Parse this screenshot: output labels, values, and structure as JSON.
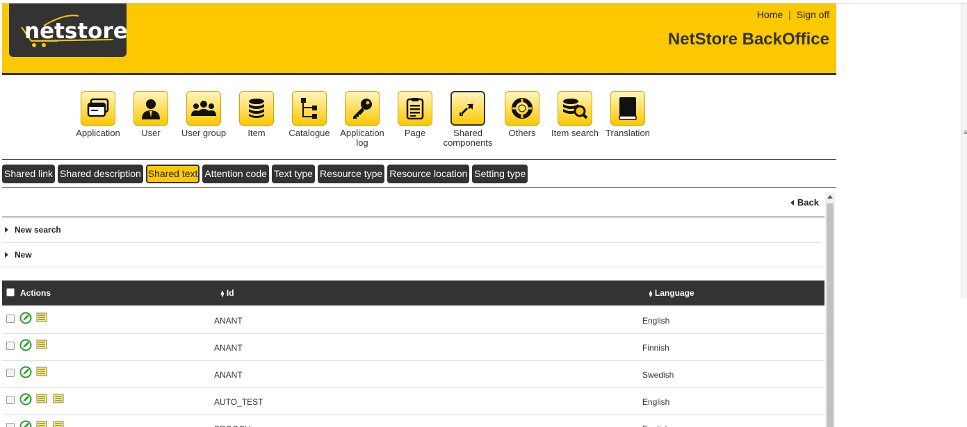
{
  "header": {
    "logo_text": "netstore",
    "links": {
      "home": "Home",
      "sep": "|",
      "signoff": "Sign off"
    },
    "title": "NetStore BackOffice"
  },
  "main_nav": [
    {
      "label": "Application",
      "icon": "application-window-icon"
    },
    {
      "label": "User",
      "icon": "user-icon"
    },
    {
      "label": "User group",
      "icon": "user-group-icon"
    },
    {
      "label": "Item",
      "icon": "item-stack-icon"
    },
    {
      "label": "Catalogue",
      "icon": "catalogue-tree-icon"
    },
    {
      "label": "Application",
      "label2": "log",
      "icon": "key-icon"
    },
    {
      "label": "Page",
      "icon": "page-document-icon"
    },
    {
      "label": "Shared",
      "label2": "components",
      "icon": "shared-link-icon",
      "active": true
    },
    {
      "label": "Others",
      "icon": "lifebuoy-icon"
    },
    {
      "label": "Item search",
      "icon": "item-search-icon"
    },
    {
      "label": "Translation",
      "icon": "book-icon"
    }
  ],
  "sub_nav": [
    {
      "label": "Shared link"
    },
    {
      "label": "Shared description"
    },
    {
      "label": "Shared text",
      "active": true
    },
    {
      "label": "Attention code"
    },
    {
      "label": "Text type"
    },
    {
      "label": "Resource type"
    },
    {
      "label": "Resource location"
    },
    {
      "label": "Setting type"
    }
  ],
  "content": {
    "back_label": "Back",
    "new_search_label": "New search",
    "new_label": "New"
  },
  "table": {
    "headers": {
      "actions": "Actions",
      "id": "Id",
      "language": "Language"
    },
    "rows": [
      {
        "id": "ANANT",
        "language": "English",
        "extra_doc": false
      },
      {
        "id": "ANANT",
        "language": "Finnish",
        "extra_doc": false
      },
      {
        "id": "ANANT",
        "language": "Swedish",
        "extra_doc": false
      },
      {
        "id": "AUTO_TEST",
        "language": "English",
        "extra_doc": true
      },
      {
        "id": "BROOCH",
        "language": "English",
        "extra_doc": true
      }
    ]
  },
  "colors": {
    "accent": "#fcc800",
    "dark": "#333333",
    "edit_green": "#2a9d2a"
  }
}
